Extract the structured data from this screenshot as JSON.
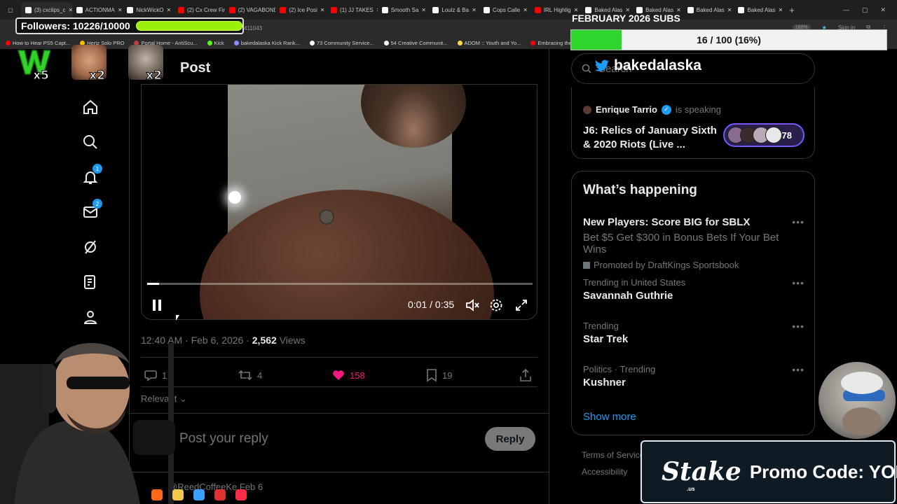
{
  "browser": {
    "tabs": [
      "(3) cxclips_c",
      "ACTIONMA",
      "NickWickO",
      "(2) Cx Crew Fin",
      "(2) VAGABOND",
      "(2) Ice Posi",
      "(1) JJ TAKES",
      "Smooth Sa",
      "Loulz & Ba",
      "Cops Calle",
      "IRL Highlig",
      "Baked Alas",
      "Baked Alas",
      "Baked Alas",
      "Baked Alas"
    ],
    "address_fragment": "411043",
    "zoom": "160%",
    "sign_in": "Sign in",
    "bookmarks": [
      "How to Hear PS5 Capt...",
      "Hertz Solo PRO",
      "Portal Home - AntiScu...",
      "Kick",
      "bakedalaska Kick Rank...",
      "73 Community Service...",
      "54 Creative Communit...",
      "ADOM :: Youth and Yo...",
      "Embracing the Cross a..."
    ]
  },
  "overlay": {
    "followers_label": "Followers: 10226/10000",
    "followers_progress": 1.0,
    "subs_title": "FEBRUARY 2026 SUBS",
    "subs_text": "16 / 100 (16%)",
    "subs_progress": 0.16,
    "emotes": [
      {
        "label": "W",
        "mult": "x5"
      },
      {
        "label": "laugh",
        "mult": "x2"
      },
      {
        "label": "face",
        "mult": "x2"
      }
    ],
    "twitter_handle": "bakedalaska",
    "stake_logo": "Stake",
    "stake_suffix": ".us",
    "stake_promo": "Promo Code: YOBA"
  },
  "header": {
    "title": "Post"
  },
  "nav": {
    "notifications_badge": "1",
    "messages_badge": "2"
  },
  "video": {
    "time": "0:01 / 0:35",
    "progress": 0.03
  },
  "post": {
    "timestamp": "12:40 AM · Feb 6, 2026 · ",
    "views_count": "2,562",
    "views_label": " Views",
    "replies": "1",
    "reposts": "4",
    "likes": "158",
    "bookmarks": "19",
    "relevant": "Relevant",
    "reply_placeholder": "Post your reply",
    "reply_button": "Reply",
    "next_post_preview": "@ReedCoffeeKe Feb 6"
  },
  "search": {
    "placeholder": "Search"
  },
  "space": {
    "host": "Enrique Tarrio",
    "status": "is speaking",
    "title": "J6: Relics of January Sixth & 2020 Riots (Live ...",
    "listener_count": "+178"
  },
  "happening": {
    "title": "What’s happening",
    "promo": {
      "title": "New Players: Score BIG for SBLX",
      "desc": "Bet $5 Get $300 in Bonus Bets If Your Bet Wins",
      "by": "Promoted by DraftKings Sportsbook"
    },
    "trends": [
      {
        "context": "Trending in United States",
        "name": "Savannah Guthrie"
      },
      {
        "context": "Trending",
        "name": "Star Trek"
      },
      {
        "context": "Politics · Trending",
        "name": "Kushner"
      }
    ],
    "show_more": "Show more"
  },
  "footer": {
    "terms": "Terms of Service",
    "accessibility": "Accessibility"
  },
  "colors": {
    "accent": "#1d9bf0",
    "like": "#f91880",
    "followers_bar": "#9bf00b",
    "subs_bar": "#2ed62e",
    "space_border": "#7856ff"
  }
}
